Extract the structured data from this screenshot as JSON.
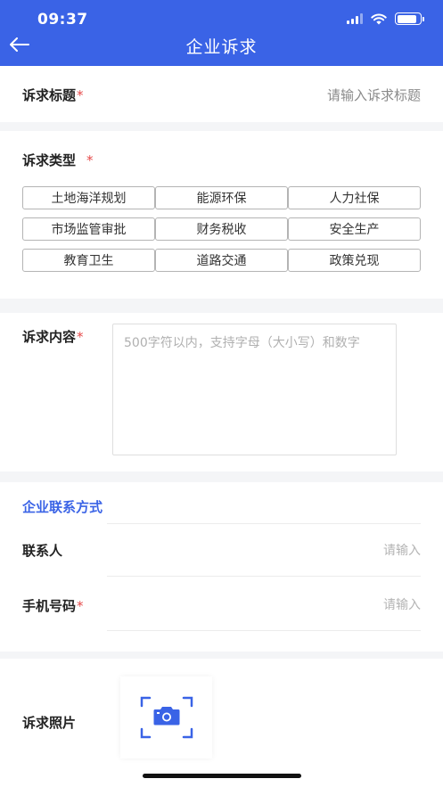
{
  "status_bar": {
    "time": "09:37"
  },
  "header": {
    "title": "企业诉求"
  },
  "form": {
    "title_field": {
      "label": "诉求标题",
      "required_mark": "*",
      "placeholder": "请输入诉求标题"
    },
    "type_field": {
      "label": "诉求类型",
      "required_mark": "*",
      "options": [
        "土地海洋规划",
        "能源环保",
        "人力社保",
        "市场监管审批",
        "财务税收",
        "安全生产",
        "教育卫生",
        "道路交通",
        "政策兑现"
      ]
    },
    "content_field": {
      "label": "诉求内容",
      "required_mark": "*",
      "placeholder": "500字符以内，支持字母（大小写）和数字"
    },
    "contact_section": {
      "heading": "企业联系方式",
      "contact_person": {
        "label": "联系人",
        "placeholder": "请输入"
      },
      "phone": {
        "label": "手机号码",
        "required_mark": "*",
        "placeholder": "请输入"
      }
    },
    "photo_field": {
      "label": "诉求照片"
    }
  },
  "colors": {
    "brand": "#3a63e6",
    "required": "#e64a4a"
  },
  "icons": {
    "back": "arrow-left-icon",
    "camera": "camera-scan-icon"
  }
}
